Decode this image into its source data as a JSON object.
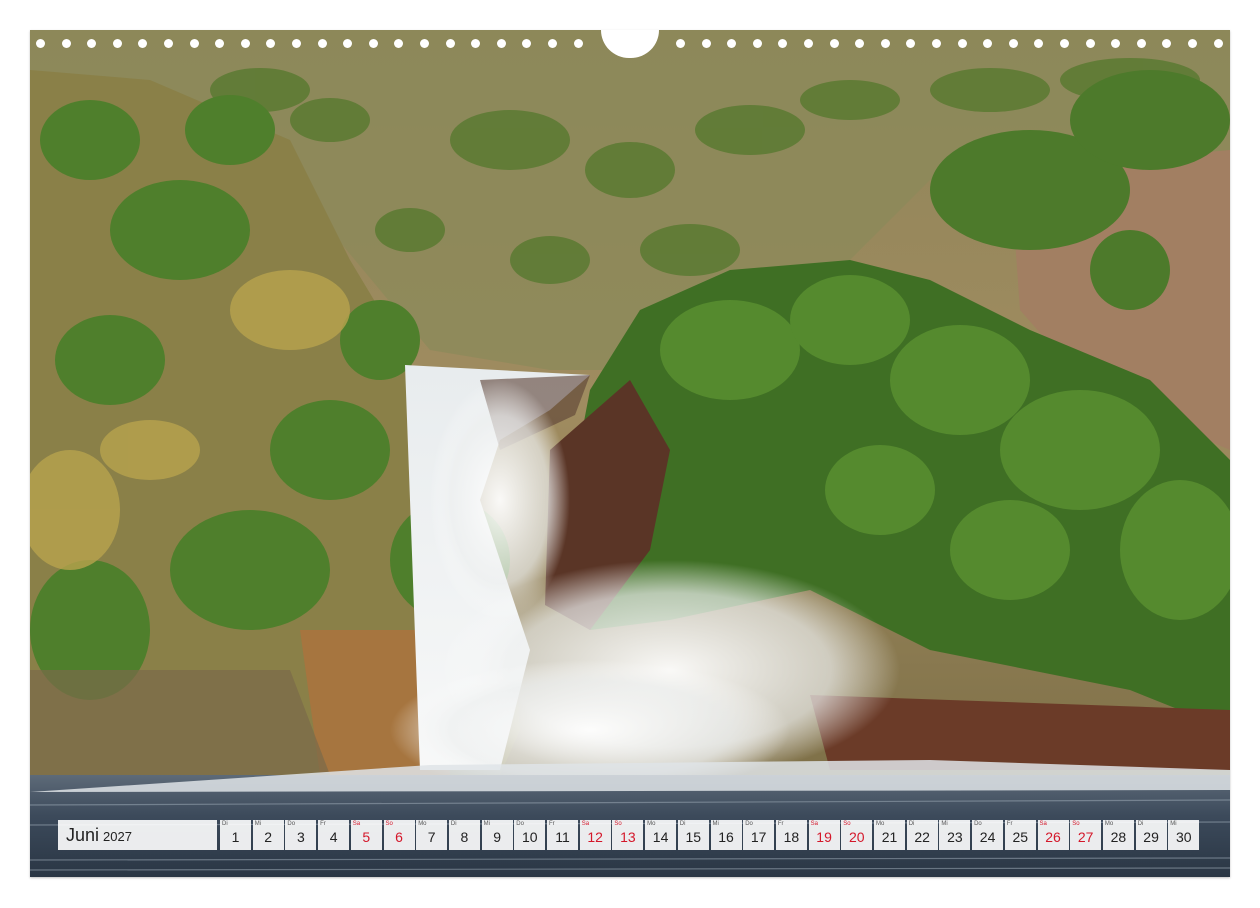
{
  "calendar": {
    "month": "Juni",
    "year": "2027",
    "days": [
      {
        "wd": "Di",
        "num": "1",
        "red": false
      },
      {
        "wd": "Mi",
        "num": "2",
        "red": false
      },
      {
        "wd": "Do",
        "num": "3",
        "red": false
      },
      {
        "wd": "Fr",
        "num": "4",
        "red": false
      },
      {
        "wd": "Sa",
        "num": "5",
        "red": true
      },
      {
        "wd": "So",
        "num": "6",
        "red": true
      },
      {
        "wd": "Mo",
        "num": "7",
        "red": false
      },
      {
        "wd": "Di",
        "num": "8",
        "red": false
      },
      {
        "wd": "Mi",
        "num": "9",
        "red": false
      },
      {
        "wd": "Do",
        "num": "10",
        "red": false
      },
      {
        "wd": "Fr",
        "num": "11",
        "red": false
      },
      {
        "wd": "Sa",
        "num": "12",
        "red": true
      },
      {
        "wd": "So",
        "num": "13",
        "red": true
      },
      {
        "wd": "Mo",
        "num": "14",
        "red": false
      },
      {
        "wd": "Di",
        "num": "15",
        "red": false
      },
      {
        "wd": "Mi",
        "num": "16",
        "red": false
      },
      {
        "wd": "Do",
        "num": "17",
        "red": false
      },
      {
        "wd": "Fr",
        "num": "18",
        "red": false
      },
      {
        "wd": "Sa",
        "num": "19",
        "red": true
      },
      {
        "wd": "So",
        "num": "20",
        "red": true
      },
      {
        "wd": "Mo",
        "num": "21",
        "red": false
      },
      {
        "wd": "Di",
        "num": "22",
        "red": false
      },
      {
        "wd": "Mi",
        "num": "23",
        "red": false
      },
      {
        "wd": "Do",
        "num": "24",
        "red": false
      },
      {
        "wd": "Fr",
        "num": "25",
        "red": false
      },
      {
        "wd": "Sa",
        "num": "26",
        "red": true
      },
      {
        "wd": "So",
        "num": "27",
        "red": true
      },
      {
        "wd": "Mo",
        "num": "28",
        "red": false
      },
      {
        "wd": "Di",
        "num": "29",
        "red": false
      },
      {
        "wd": "Mi",
        "num": "30",
        "red": false
      }
    ]
  },
  "colors": {
    "weekend_red": "#d4172a",
    "foliage_green": "#4f7f2c",
    "dry_hillside": "#9c8a5a",
    "rock_brown": "#6b3b28",
    "water_blue": "#3a4a5c"
  }
}
